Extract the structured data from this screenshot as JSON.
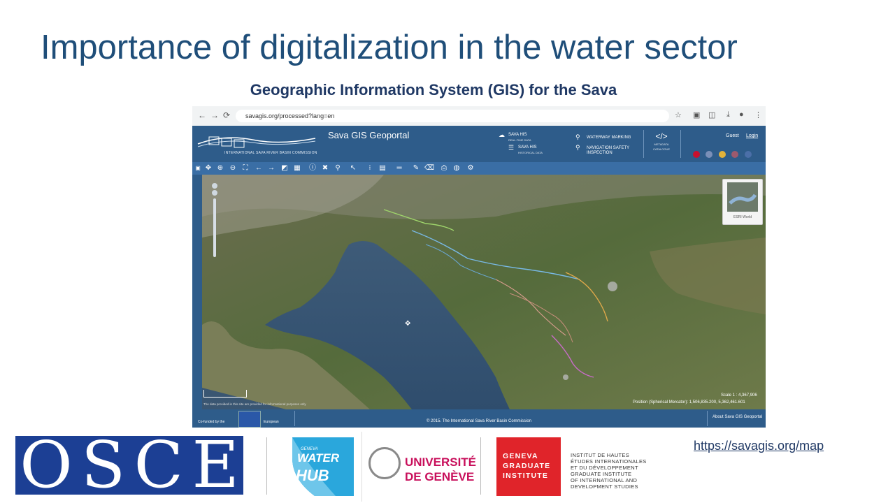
{
  "slide": {
    "title": "Importance of digitalization in the water sector",
    "subtitle": "Geographic Information System (GIS) for the Sava",
    "link": "https://savagis.org/map"
  },
  "browser": {
    "url": "savagis.org/processed?lang=en"
  },
  "geoportal": {
    "logo_caption": "INTERNATIONAL SAVA RIVER BASIN COMMISSION",
    "title": "Sava GIS Geoportal",
    "menu": [
      {
        "label": "SAVA HIS",
        "sub": "REAL-TIME DATA"
      },
      {
        "label": "SAVA HIS",
        "sub": "HISTORICAL DATA"
      },
      {
        "label": "WATERWAY MARKING",
        "sub": ""
      },
      {
        "label": "NAVIGATION SAFETY",
        "sub": "INSPECTION"
      }
    ],
    "metadata_label": "METADATA",
    "metadata_sub": "CATALOGUE",
    "guest": "Guest",
    "login": "Login",
    "basemap_label": "ESRI World",
    "scale": "Scale 1 : 4,367,906",
    "position": "Position (Spherical Mercator): 1,506,835.200, 5,362,461.601",
    "disclaimer": "The data provided in this site are provided for informational purposes only",
    "footer_copy": "© 2015. The International Sava River Basin Commission",
    "footer_about": "About Sava GIS Geoportal",
    "footer_funded": "Co-funded by the",
    "footer_eu": "European"
  },
  "logos": {
    "osce": [
      "O",
      "S",
      "C",
      "E"
    ],
    "waterhub_small": "GENEVA",
    "waterhub_1": "WATER",
    "waterhub_2": "HUB",
    "unige": [
      "UNIVERSITÉ",
      "DE GENÈVE"
    ],
    "ggi": [
      "GENEVA",
      "GRADUATE",
      "INSTITUTE"
    ],
    "ggi_desc": [
      "INSTITUT DE HAUTES",
      "ÉTUDES INTERNATIONALES",
      "ET DU DÉVELOPPEMENT",
      "GRADUATE INSTITUTE",
      "OF INTERNATIONAL AND",
      "DEVELOPMENT STUDIES"
    ]
  },
  "colors": {
    "title": "#1f4e79",
    "header": "#2e5c8a",
    "osce": "#1c3f94",
    "unige": "#c80f5b",
    "ggi": "#e0242a"
  }
}
